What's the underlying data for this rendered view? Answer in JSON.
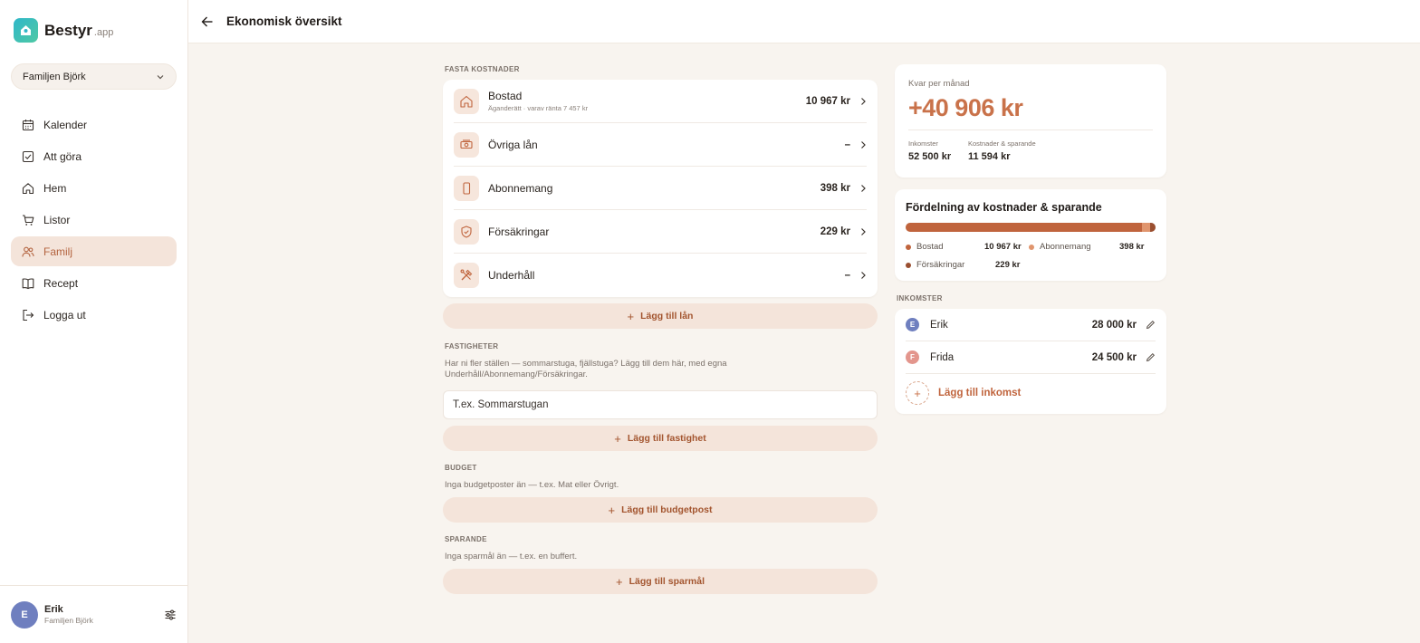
{
  "app": {
    "brand": "Bestyr",
    "brand_suffix": ".app"
  },
  "sidebar": {
    "family_select": "Familjen Björk",
    "items": [
      {
        "label": "Kalender",
        "icon": "calendar-icon"
      },
      {
        "label": "Att göra",
        "icon": "checkbox-icon"
      },
      {
        "label": "Hem",
        "icon": "home-icon"
      },
      {
        "label": "Listor",
        "icon": "cart-icon"
      },
      {
        "label": "Familj",
        "icon": "people-icon",
        "active": true
      },
      {
        "label": "Recept",
        "icon": "book-icon"
      },
      {
        "label": "Logga ut",
        "icon": "logout-icon"
      }
    ],
    "user": {
      "initial": "E",
      "name": "Erik",
      "family": "Familjen Björk"
    }
  },
  "header": {
    "title": "Ekonomisk översikt"
  },
  "fixed_costs": {
    "label": "FASTA KOSTNADER",
    "rows": [
      {
        "title": "Bostad",
        "subtitle": "Äganderätt · varav ränta 7 457 kr",
        "amount": "10 967 kr",
        "icon": "house-icon"
      },
      {
        "title": "Övriga lån",
        "subtitle": "",
        "amount": "–",
        "icon": "money-icon"
      },
      {
        "title": "Abonnemang",
        "subtitle": "",
        "amount": "398 kr",
        "icon": "phone-icon"
      },
      {
        "title": "Försäkringar",
        "subtitle": "",
        "amount": "229 kr",
        "icon": "shield-icon"
      },
      {
        "title": "Underhåll",
        "subtitle": "",
        "amount": "–",
        "icon": "tools-icon"
      }
    ],
    "add_label": "Lägg till lån"
  },
  "properties": {
    "label": "FASTIGHETER",
    "helper": "Har ni fler ställen — sommarstuga, fjällstuga? Lägg till dem här, med egna Underhåll/Abonnemang/Försäkringar.",
    "input_placeholder": "T.ex. Sommarstugan",
    "add_label": "Lägg till fastighet"
  },
  "budget": {
    "label": "BUDGET",
    "helper": "Inga budgetposter än — t.ex. Mat eller Övrigt.",
    "add_label": "Lägg till budgetpost"
  },
  "savings": {
    "label": "SPARANDE",
    "helper": "Inga sparmål än — t.ex. en buffert.",
    "add_label": "Lägg till sparmål"
  },
  "summary": {
    "label": "Kvar per månad",
    "value": "+40 906 kr",
    "income_label": "Inkomster",
    "income_value": "52 500 kr",
    "costs_label": "Kostnader & sparande",
    "costs_value": "11 594 kr"
  },
  "distribution": {
    "title": "Fördelning av kostnader & sparande",
    "segments": [
      {
        "name": "Bostad",
        "value": "10 967 kr",
        "share": 0.946,
        "color": "#c0643d"
      },
      {
        "name": "Abonnemang",
        "value": "398 kr",
        "share": 0.034,
        "color": "#e0956e"
      },
      {
        "name": "Försäkringar",
        "value": "229 kr",
        "share": 0.02,
        "color": "#9a4f30"
      }
    ]
  },
  "incomes": {
    "label": "INKOMSTER",
    "rows": [
      {
        "initial": "E",
        "name": "Erik",
        "amount": "28 000 kr",
        "color": "#6f7fbf"
      },
      {
        "initial": "F",
        "name": "Frida",
        "amount": "24 500 kr",
        "color": "#e3968d"
      }
    ],
    "add_label": "Lägg till inkomst"
  }
}
